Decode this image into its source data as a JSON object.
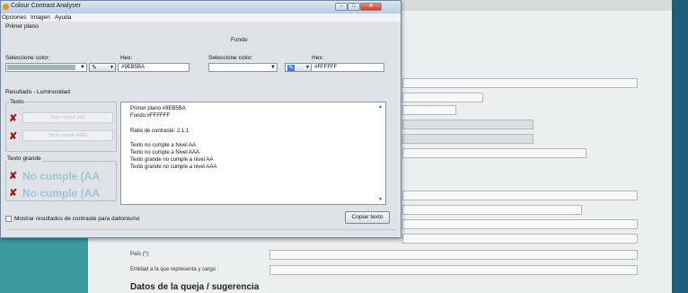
{
  "colors": {
    "foreground": "#9EB5BA",
    "background": "#FFFFFF",
    "fail_icon": "#9a1c16",
    "fail_big_text": "#9fc5d4"
  },
  "window": {
    "title": "Colour Contrast Analyser",
    "close_icon": "close-icon"
  },
  "menu": {
    "items": [
      "Opciones",
      "Imagen",
      "Ayuda"
    ]
  },
  "foreground": {
    "section_label": "Primer plano",
    "select_label": "Seleccione color:",
    "hex_label": "Hex:",
    "hex_value": "#9EB5BA"
  },
  "background_color": {
    "section_label": "Fondo",
    "select_label": "Seleccione color:",
    "hex_label": "Hex:",
    "hex_value": "#FFFFFF"
  },
  "result_panel": {
    "section_label": "Resultado - Luminosidad",
    "text_group": "Texto",
    "sample_1": "Texto normal (AA)",
    "sample_2": "Texto normal (AAA)",
    "large_group": "Texto grande",
    "large_1": "No cumple (AA",
    "large_2": "No cumple (AA"
  },
  "results_text": [
    "Primer plano:#9EB5BA",
    "Fondo:#FFFFFF",
    "Ratio de contraste: 2,1:1",
    "Texto no cumple a Nivel AA",
    "Texto no cumple a Nivel AAA",
    "Texto grande no cumple a nivel AA",
    "Texto grande no cumple a nivel AAA"
  ],
  "footer": {
    "checkbox_label": "Mostrar resultados de contraste para daltonismo",
    "copy_button": "Copiar texto"
  },
  "background_page": {
    "label_pais": "País (*):",
    "label_entidad": "Entidad a la que representa y cargo :",
    "heading": "Datos de la queja / sugerencia"
  }
}
